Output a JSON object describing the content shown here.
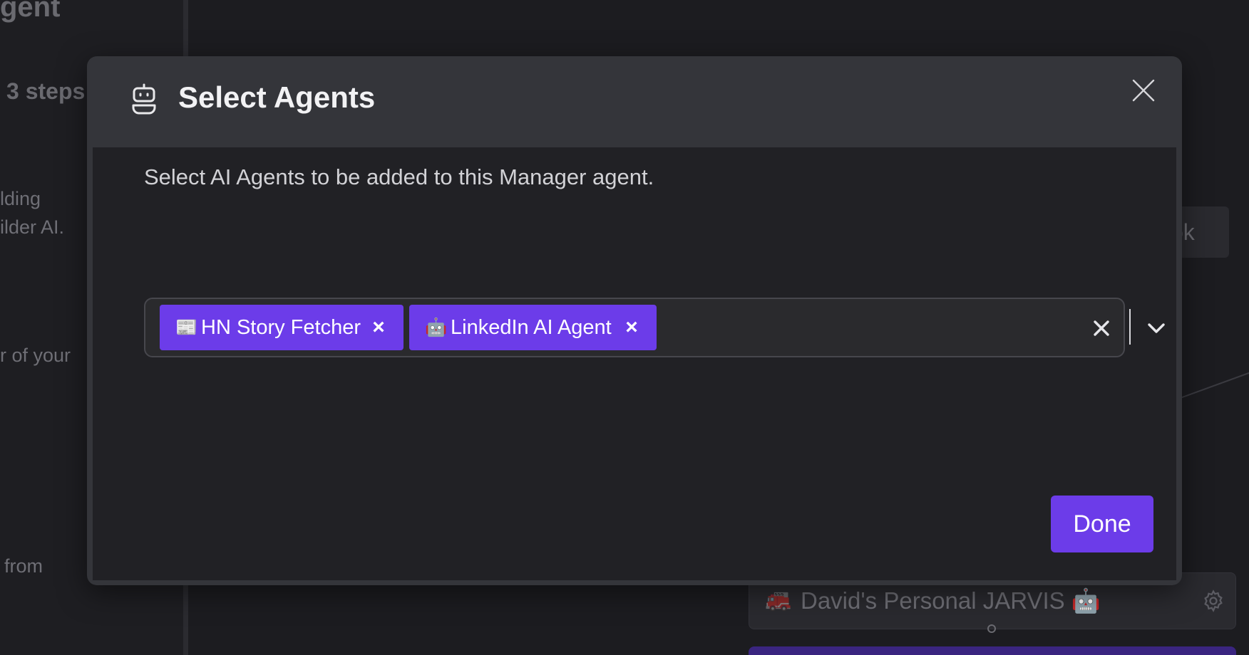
{
  "background": {
    "title_fragment": "gent",
    "steps_fragment": "3 steps",
    "text_fragment_1": "lding",
    "text_fragment_2": "ilder AI.",
    "text_fragment_3": "r of your",
    "text_fragment_4": "from",
    "button_fragment": "ok",
    "agent_card": {
      "emoji": "🚒",
      "label": "David's Personal JARVIS 🤖"
    }
  },
  "modal": {
    "icon": "robot-icon",
    "title": "Select Agents",
    "prompt": "Select AI Agents to be added to this Manager agent.",
    "selected_agents": [
      {
        "emoji": "📰",
        "label": "HN Story Fetcher",
        "remove": "×"
      },
      {
        "emoji": "🤖",
        "label": "LinkedIn AI Agent",
        "remove": "×"
      }
    ],
    "done_label": "Done"
  },
  "colors": {
    "accent": "#6c3ce9",
    "modal_header": "#34353a",
    "modal_body": "#212125"
  }
}
